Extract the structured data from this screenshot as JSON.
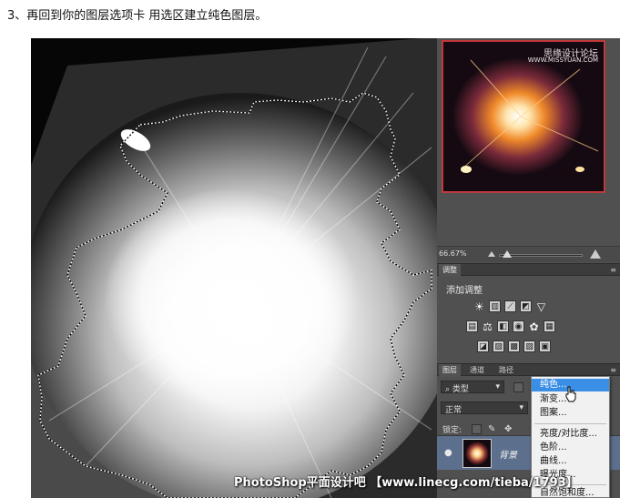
{
  "caption": "3、再回到你的图层选项卡 用选区建立纯色图层。",
  "navigator": {
    "watermark_title": "思缘设计论坛",
    "watermark_url": "WWW.MISSYUAN.COM"
  },
  "zoom": "66.67%",
  "adjust_panel": {
    "tab": "调整",
    "title": "添加调整"
  },
  "layers_panel": {
    "tabs": [
      "图层",
      "通道",
      "路径"
    ],
    "filter_kind": "类型",
    "blend_mode": "正常",
    "lock_label": "锁定:",
    "layer_name": "背景"
  },
  "popup_menu": {
    "items": [
      "纯色...",
      "渐变...",
      "图案...",
      "亮度/对比度...",
      "色阶...",
      "曲线...",
      "曝光度...",
      "自然饱和度..."
    ]
  },
  "watermark": "PhotoShop平面设计吧 【www.linecg.com/tieba/1793】",
  "colors": {
    "panel_bg": "#505050",
    "highlight": "#3a8ee6",
    "navigator_border": "#c0393b",
    "layer_selected": "#5c6f8c"
  }
}
